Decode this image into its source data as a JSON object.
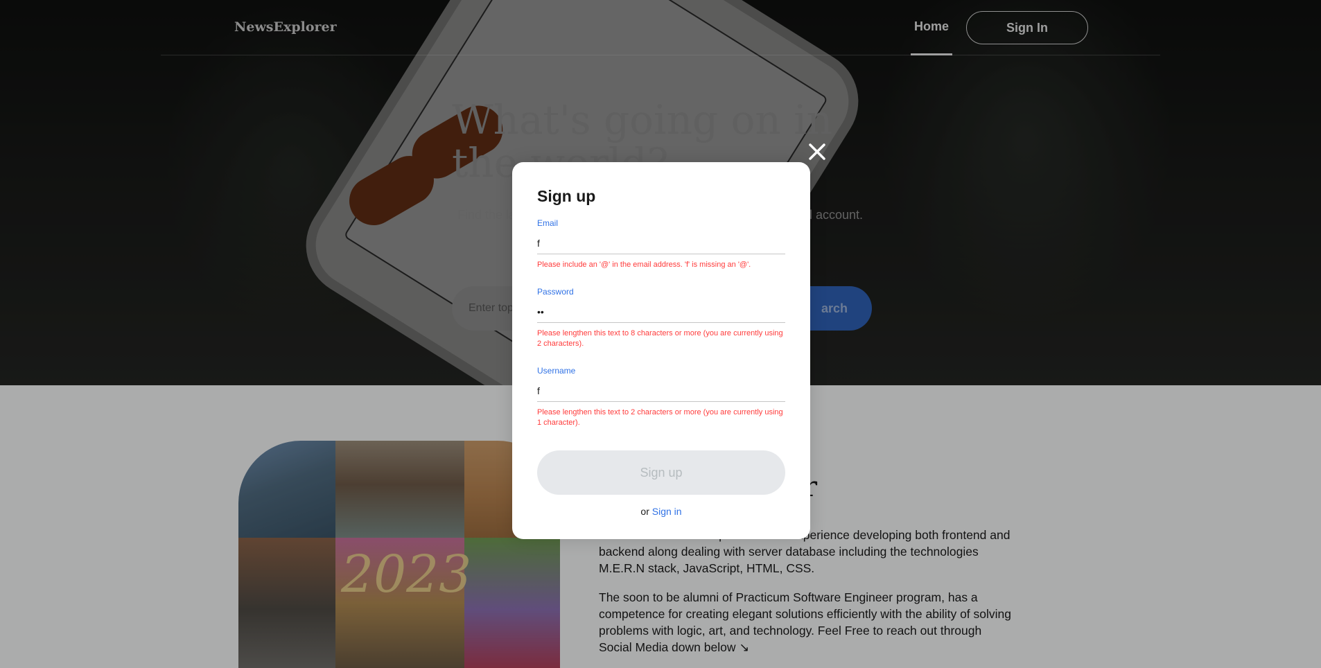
{
  "header": {
    "logo": "NewsExplorer",
    "nav_home": "Home",
    "nav_sign_in": "Sign In"
  },
  "hero": {
    "title": "What's going on in the world?",
    "subtitle_start": "Find the la",
    "subtitle_end": "l account.",
    "search_placeholder": "Enter top",
    "search_button": "arch"
  },
  "about": {
    "collage_text": "2023",
    "title_tail": "r",
    "paragraph1": "ecent full-stack developer. She has experience developing both frontend and backend along dealing with server database including the technologies M.E.R.N stack, JavaScript, HTML, CSS.",
    "paragraph2": "The soon to be alumni of Practicum Software Engineer program, has a competence for creating elegant solutions efficiently with the ability of solving problems with logic, art, and technology. Feel Free to reach out through Social Media down below ↘"
  },
  "modal": {
    "title": "Sign up",
    "email": {
      "label": "Email",
      "value": "f",
      "error": "Please include an '@' in the email address. 'f' is missing an '@'."
    },
    "password": {
      "label": "Password",
      "value": "ff",
      "error": "Please lengthen this text to 8 characters or more (you are currently using 2 characters)."
    },
    "username": {
      "label": "Username",
      "value": "f",
      "error": "Please lengthen this text to 2 characters or more (you are currently using 1 character)."
    },
    "submit_label": "Sign up",
    "switch_prefix": "or ",
    "switch_link": "Sign in"
  },
  "colors": {
    "accent": "#2f71e5",
    "error": "#ff3a3a",
    "search_button": "#2f61b5",
    "disabled_button": "#e6e8eb"
  },
  "icons": {
    "close": "close-icon"
  }
}
